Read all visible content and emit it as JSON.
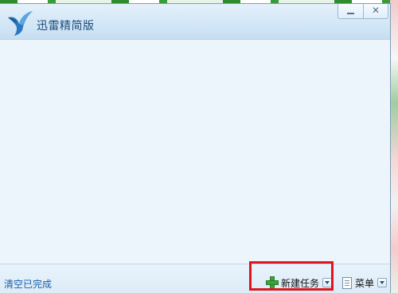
{
  "window": {
    "title": "迅雷精简版",
    "minimize_glyph": "",
    "close_glyph": "✕"
  },
  "statusbar": {
    "clear_completed": "清空已完成",
    "new_task": "新建任务",
    "menu": "菜单"
  },
  "icons": {
    "logo": "thunder-bird-logo",
    "new_task": "plus-icon",
    "menu": "document-icon"
  },
  "colors": {
    "accent": "#1a5fa8",
    "highlight": "#e0141c",
    "plus": "#3aa33a"
  }
}
